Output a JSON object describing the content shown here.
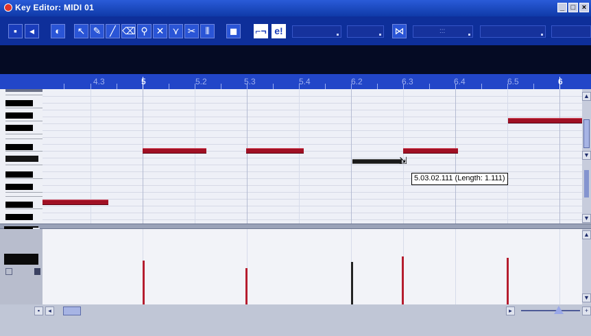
{
  "window": {
    "title": "Key Editor: MIDI 01",
    "minimize_label": "_",
    "maximize_label": "□",
    "close_label": "×"
  },
  "toolbar": {
    "tools": [
      {
        "name": "solo-button-icon",
        "glyph": "▪"
      },
      {
        "name": "feedback-icon",
        "glyph": "◂"
      },
      {
        "name": "autoscroll-icon",
        "glyph": "◐"
      },
      {
        "name": "object-select-icon",
        "glyph": "↖"
      },
      {
        "name": "draw-icon",
        "glyph": "✎"
      },
      {
        "name": "line-icon",
        "glyph": "╱"
      },
      {
        "name": "erase-icon",
        "glyph": "⌫"
      },
      {
        "name": "zoom-icon",
        "glyph": "⚲"
      },
      {
        "name": "mute-icon",
        "glyph": "✕"
      },
      {
        "name": "glue-icon",
        "glyph": "⋎"
      },
      {
        "name": "split-icon",
        "glyph": "✂"
      },
      {
        "name": "drumstick-icon",
        "glyph": "⦀"
      },
      {
        "name": "color-icon",
        "glyph": "◼"
      }
    ],
    "snap_label": "⌐¬",
    "edit_label": "e!",
    "quantize_label": "⋈",
    "value_dots": ":::"
  },
  "ruler": {
    "labels": [
      "4.3",
      "5",
      "5.2",
      "5.3",
      "5.4",
      "6",
      "6.2",
      "6.3",
      "6.4",
      "6.5",
      "6"
    ],
    "highlight": [
      "5",
      "6"
    ]
  },
  "notes": {
    "tooltip": "5.03.02.111 (Length: 1.111)",
    "color": "#a01024"
  },
  "velocity": {
    "color": "#b51c2e"
  }
}
